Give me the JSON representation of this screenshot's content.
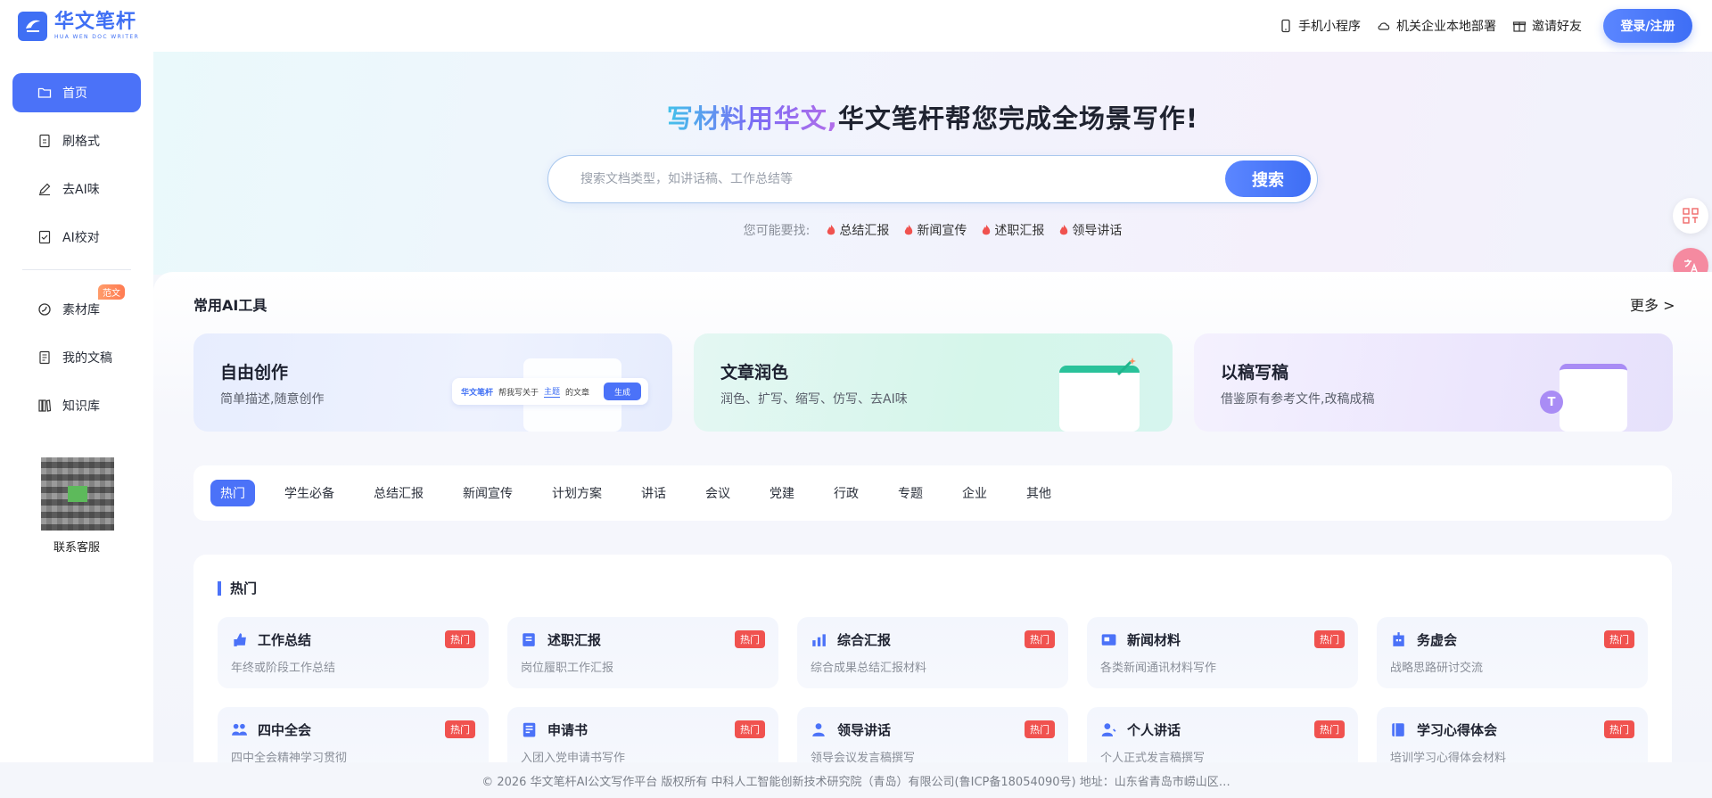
{
  "header": {
    "logo_cn": "华文笔杆",
    "logo_en": "HUA WEN DOC WRITER",
    "mini_program": "手机小程序",
    "local_deploy": "机关企业本地部署",
    "invite": "邀请好友",
    "login": "登录/注册"
  },
  "sidebar": {
    "items": [
      {
        "label": "首页",
        "icon": "folder-icon"
      },
      {
        "label": "刷格式",
        "icon": "document-icon"
      },
      {
        "label": "去AI味",
        "icon": "pen-icon"
      },
      {
        "label": "AI校对",
        "icon": "check-doc-icon"
      },
      {
        "label": "素材库",
        "icon": "circle-icon",
        "badge": "范文"
      },
      {
        "label": "我的文稿",
        "icon": "file-icon"
      },
      {
        "label": "知识库",
        "icon": "books-icon"
      }
    ],
    "service_label": "联系客服"
  },
  "hero": {
    "title_highlight": "写材料用华文,",
    "title_rest": "华文笔杆帮您完成全场景写作!",
    "search_placeholder": "搜索文档类型，如讲话稿、工作总结等",
    "search_button": "搜索",
    "suggest_label": "您可能要找:",
    "suggestions": [
      "总结汇报",
      "新闻宣传",
      "述职汇报",
      "领导讲话"
    ]
  },
  "tools": {
    "title": "常用AI工具",
    "more": "更多 >",
    "cards": [
      {
        "title": "自由创作",
        "desc": "简单描述,随意创作"
      },
      {
        "title": "文章润色",
        "desc": "润色、扩写、缩写、仿写、去AI味"
      },
      {
        "title": "以稿写稿",
        "desc": "借鉴原有参考文件,改稿成稿"
      }
    ],
    "mini": {
      "logo": "华文笔杆",
      "prefix": "帮我写关于",
      "topic": "主题",
      "suffix": "的文章",
      "button": "生成"
    }
  },
  "tabs": [
    "热门",
    "学生必备",
    "总结汇报",
    "新闻宣传",
    "计划方案",
    "讲话",
    "会议",
    "党建",
    "行政",
    "专题",
    "企业",
    "其他"
  ],
  "hot": {
    "title": "热门",
    "badge": "热门",
    "cards": [
      {
        "title": "工作总结",
        "desc": "年终或阶段工作总结",
        "icon": "thumb-icon"
      },
      {
        "title": "述职汇报",
        "desc": "岗位履职工作汇报",
        "icon": "report-icon"
      },
      {
        "title": "综合汇报",
        "desc": "综合成果总结汇报材料",
        "icon": "chart-icon"
      },
      {
        "title": "新闻材料",
        "desc": "各类新闻通讯材料写作",
        "icon": "news-icon"
      },
      {
        "title": "务虚会",
        "desc": "战略思路研讨交流",
        "icon": "building-icon"
      },
      {
        "title": "四中全会",
        "desc": "四中全会精神学习贯彻",
        "icon": "people-icon"
      },
      {
        "title": "申请书",
        "desc": "入团入党申请书写作",
        "icon": "form-icon"
      },
      {
        "title": "领导讲话",
        "desc": "领导会议发言稿撰写",
        "icon": "speaker-icon"
      },
      {
        "title": "个人讲话",
        "desc": "个人正式发言稿撰写",
        "icon": "person-icon"
      },
      {
        "title": "学习心得体会",
        "desc": "培训学习心得体会材料",
        "icon": "book-icon"
      }
    ]
  },
  "footer": "© 2026 华文笔杆AI公文写作平台 版权所有 中科人工智能创新技术研究院（青岛）有限公司(鲁ICP备18054090号) 地址：山东省青岛市崂山区…",
  "colors": {
    "accent": "#4b72f8",
    "badge_red": "#f0524f",
    "badge_orange": "#ff7b52"
  }
}
